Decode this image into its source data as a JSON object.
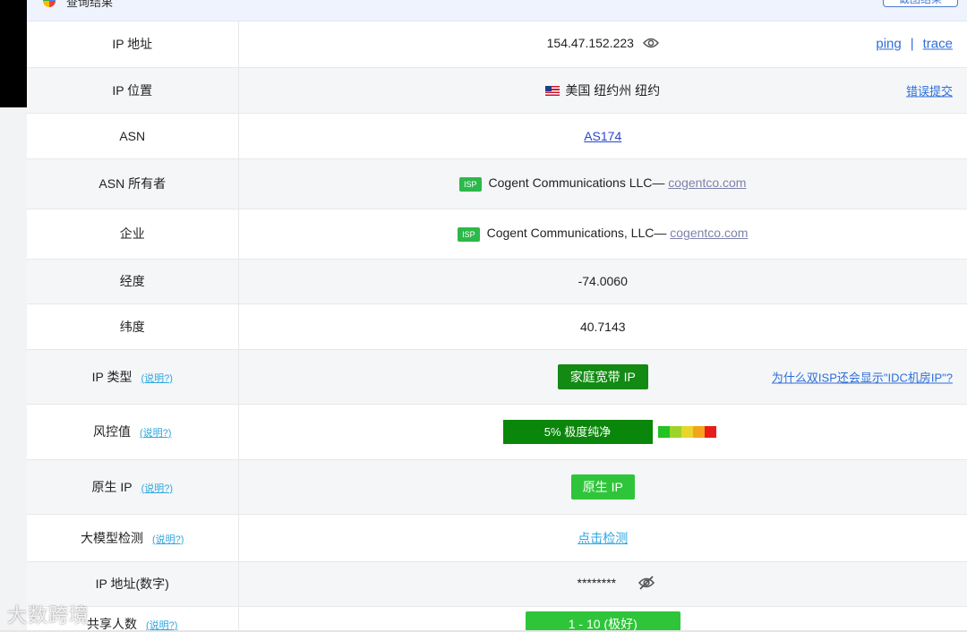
{
  "header": {
    "title": "查询结果",
    "corner_button": "截图结果"
  },
  "rows": {
    "ip": {
      "label": "IP 地址",
      "value": "154.47.152.223",
      "ping": "ping",
      "sep": "|",
      "trace": "trace"
    },
    "location": {
      "label": "IP 位置",
      "value": "美国 纽约州 纽约",
      "report": "错误提交"
    },
    "asn": {
      "label": "ASN",
      "value": "AS174"
    },
    "asn_owner": {
      "label": "ASN 所有者",
      "badge": "ISP",
      "name": "Cogent Communications LLC—",
      "domain": "cogentco.com"
    },
    "company": {
      "label": "企业",
      "badge": "ISP",
      "name": "Cogent Communications, LLC—",
      "domain": "cogentco.com"
    },
    "longitude": {
      "label": "经度",
      "value": "-74.0060"
    },
    "latitude": {
      "label": "纬度",
      "value": "40.7143"
    },
    "ip_type": {
      "label": "IP 类型",
      "help": "(说明?)",
      "value": "家庭宽带 IP",
      "why": "为什么双ISP还会显示\"IDC机房IP\"?"
    },
    "risk": {
      "label": "风控值",
      "help": "(说明?)",
      "value": "5%   极度纯净",
      "percent": 5,
      "scale_colors": [
        "#22c322",
        "#9fd32a",
        "#e8d62a",
        "#f5a31e",
        "#e81c1c"
      ]
    },
    "native": {
      "label": "原生 IP",
      "help": "(说明?)",
      "value": "原生 IP"
    },
    "llm": {
      "label": "大模型检测",
      "help": "(说明?)",
      "value": "点击检测"
    },
    "ip_numeric": {
      "label": "IP 地址(数字)",
      "value": "********"
    },
    "shared": {
      "label": "共享人数",
      "help": "(说明?)",
      "value": "1 - 10 (极好)"
    }
  },
  "watermark": "大数跨境"
}
